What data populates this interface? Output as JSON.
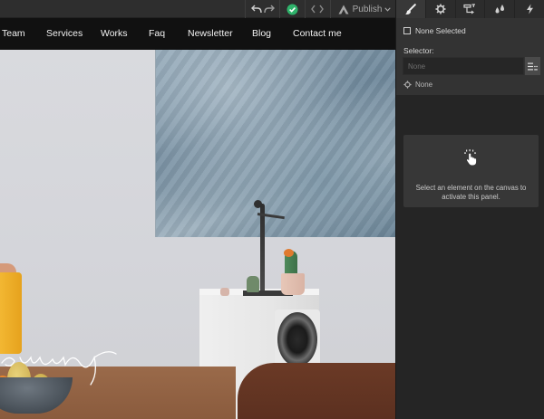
{
  "toolbar": {
    "publish_label": "Publish",
    "icons": [
      "undo-icon",
      "redo-icon",
      "check-circle-icon",
      "code-icon",
      "publish-logo-icon",
      "chevron-down-icon"
    ],
    "status_color": "#2fb36b"
  },
  "site_nav": {
    "links": [
      "Team",
      "Services",
      "Works",
      "Faq",
      "Newsletter",
      "Blog",
      "Contact me"
    ]
  },
  "panel": {
    "tabs": [
      "paintbrush-icon",
      "gear-icon",
      "layer-manager-icon",
      "drops-icon",
      "lightning-icon"
    ],
    "none_selected_label": "None Selected",
    "selector_label": "Selector:",
    "selector_placeholder": "None",
    "state_label": "None",
    "empty_message": "Select an element on the canvas to activate this panel."
  }
}
